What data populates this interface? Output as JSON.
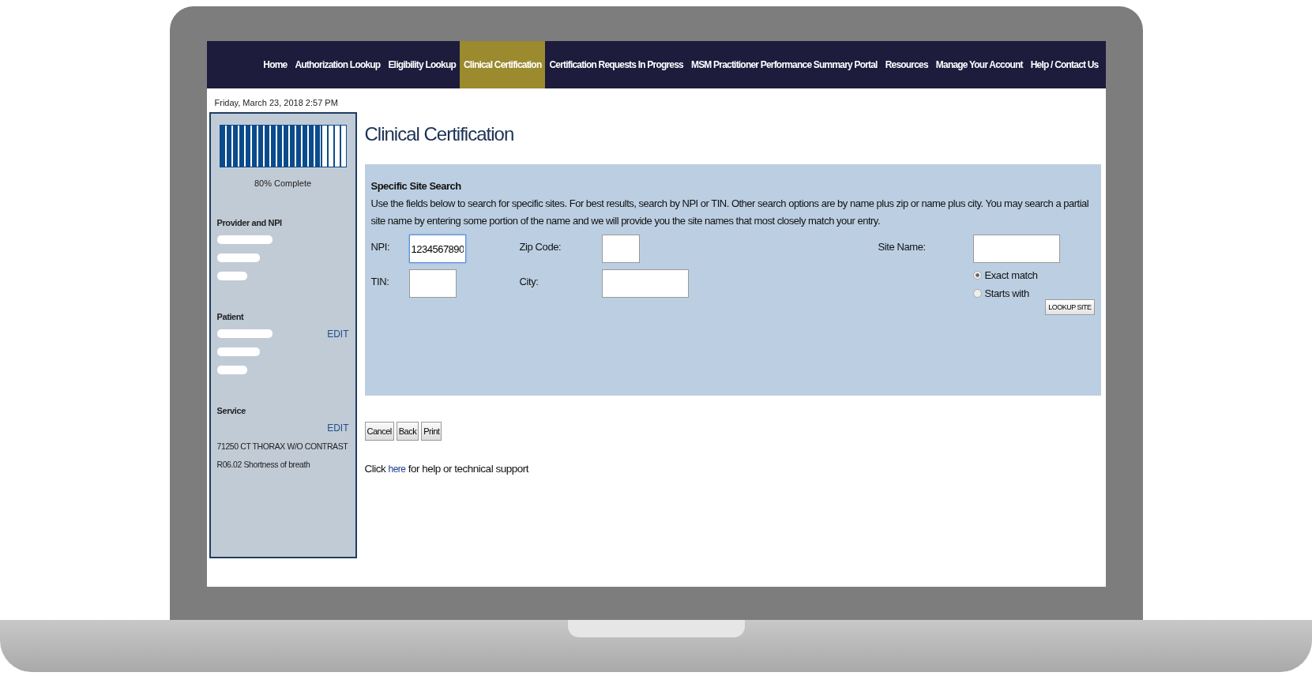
{
  "nav": {
    "items": [
      {
        "label": "Home",
        "selected": false
      },
      {
        "label": "Authorization Lookup",
        "selected": false
      },
      {
        "label": "Eligibility Lookup",
        "selected": false
      },
      {
        "label": "Clinical Certification",
        "selected": true
      },
      {
        "label": "Certification Requests In Progress",
        "selected": false
      },
      {
        "label": "MSM Practitioner Performance Summary Portal",
        "selected": false
      },
      {
        "label": "Resources",
        "selected": false
      },
      {
        "label": "Manage Your Account",
        "selected": false
      },
      {
        "label": "Help / Contact Us",
        "selected": false
      }
    ]
  },
  "timestamp": "Friday, March 23, 2018 2:57 PM",
  "sidebar": {
    "progress": {
      "level": 0.8,
      "label": "80% Complete"
    },
    "sections": [
      {
        "heading": "Provider and NPI",
        "lines": [
          {
            "kind": "redacted"
          },
          {
            "kind": "redacted"
          },
          {
            "kind": "redacted"
          }
        ]
      },
      {
        "heading": "Patient",
        "edit": "EDIT",
        "lines": [
          {
            "kind": "redacted"
          },
          {
            "kind": "redacted"
          },
          {
            "kind": "redacted"
          }
        ]
      },
      {
        "heading": "Service",
        "edit": "EDIT",
        "lines": [
          {
            "kind": "text",
            "text": "71250 CT THORAX W/O CONTRAST"
          },
          {
            "kind": "text",
            "text": "R06.02 Shortness of breath"
          }
        ]
      }
    ]
  },
  "page_title": "Clinical Certification",
  "search_panel": {
    "title": "Specific Site Search",
    "description": "Use the fields below to search for specific sites. For best results, search by NPI or TIN. Other search options are by name plus zip or name plus city. You may search a partial site name by entering some portion of the name and we will provide you the site names that most closely match your entry.",
    "npi": {
      "label": "NPI:",
      "value": "1234567890",
      "focused": true
    },
    "tin": {
      "label": "TIN:"
    },
    "zip": {
      "label": "Zip Code:"
    },
    "city": {
      "label": "City:"
    },
    "site_name": {
      "label": "Site Name:"
    },
    "match_options": [
      {
        "label": "Exact match",
        "selected": true
      },
      {
        "label": "Starts with",
        "selected": false
      }
    ],
    "lookup_button": "LOOKUP SITE"
  },
  "buttons": [
    "Cancel",
    "Back",
    "Print"
  ],
  "help": {
    "before": "Click",
    "link": "here",
    "after": "for help or technical support"
  }
}
